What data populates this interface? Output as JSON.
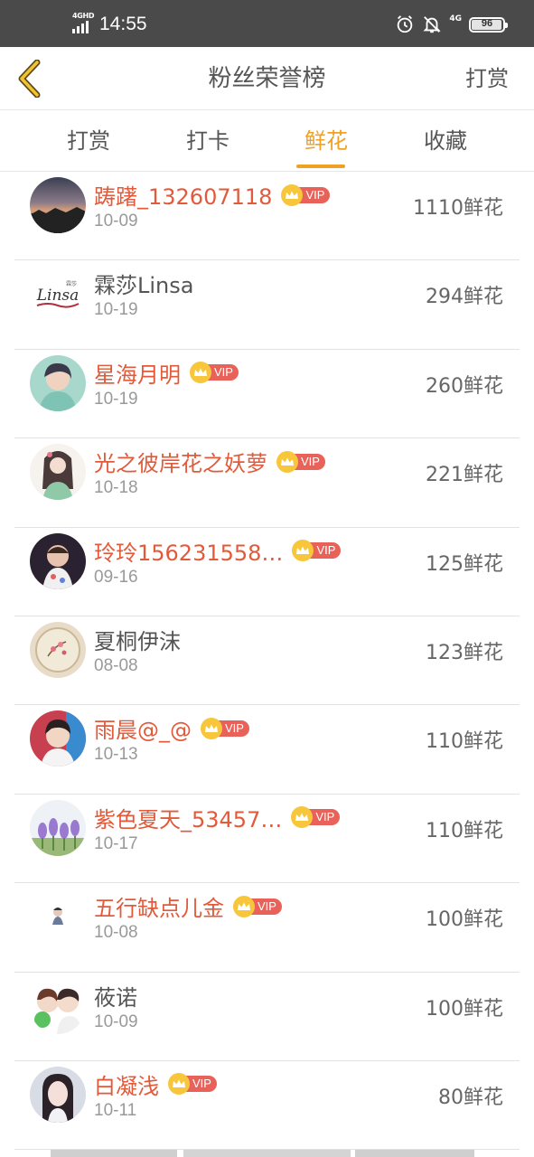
{
  "status_bar": {
    "signal_label": "4GHD",
    "time": "14:55",
    "network": "4G",
    "battery": "96",
    "battery_level": 0.96,
    "icons": [
      "alarm-icon",
      "bell-off-icon"
    ]
  },
  "header": {
    "back_icon": "chevron-left-icon",
    "title": "粉丝荣誉榜",
    "right_action": "打赏"
  },
  "tabs": [
    {
      "label": "打赏",
      "active": false
    },
    {
      "label": "打卡",
      "active": false
    },
    {
      "label": "鲜花",
      "active": true
    },
    {
      "label": "收藏",
      "active": false
    }
  ],
  "colors": {
    "accent": "#f0a024",
    "vip_name": "#e25a3a",
    "vip_tag": "#e9625a",
    "vip_crown": "#f7c63a"
  },
  "vip_label": "VIP",
  "rows": [
    {
      "name": "踌躇_132607118",
      "date": "10-09",
      "amount": "1110鲜花",
      "vip": true,
      "avatar": "sunset-city-avatar"
    },
    {
      "name": "霖莎Linsa",
      "date": "10-19",
      "amount": "294鲜花",
      "vip": false,
      "avatar": "linsa-logo-avatar",
      "avatar_text": "Linsa"
    },
    {
      "name": "星海月明",
      "date": "10-19",
      "amount": "260鲜花",
      "vip": true,
      "avatar": "girl-avatar"
    },
    {
      "name": "光之彼岸花之妖萝",
      "date": "10-18",
      "amount": "221鲜花",
      "vip": true,
      "avatar": "anime-girl-avatar"
    },
    {
      "name": "玲玲156231558…",
      "date": "09-16",
      "amount": "125鲜花",
      "vip": true,
      "avatar": "baby-avatar"
    },
    {
      "name": "夏桐伊沫",
      "date": "08-08",
      "amount": "123鲜花",
      "vip": false,
      "avatar": "fan-painting-avatar"
    },
    {
      "name": "雨晨@_@",
      "date": "10-13",
      "amount": "110鲜花",
      "vip": true,
      "avatar": "boy-avatar"
    },
    {
      "name": "紫色夏天_53457…",
      "date": "10-17",
      "amount": "110鲜花",
      "vip": true,
      "avatar": "purple-flowers-avatar"
    },
    {
      "name": "五行缺点儿金",
      "date": "10-08",
      "amount": "100鲜花",
      "vip": true,
      "avatar": "small-figure-avatar"
    },
    {
      "name": "莜诺",
      "date": "10-09",
      "amount": "100鲜花",
      "vip": false,
      "avatar": "cartoon-couple-avatar"
    },
    {
      "name": "白凝浅",
      "date": "10-11",
      "amount": "80鲜花",
      "vip": true,
      "avatar": "portrait-avatar"
    }
  ]
}
